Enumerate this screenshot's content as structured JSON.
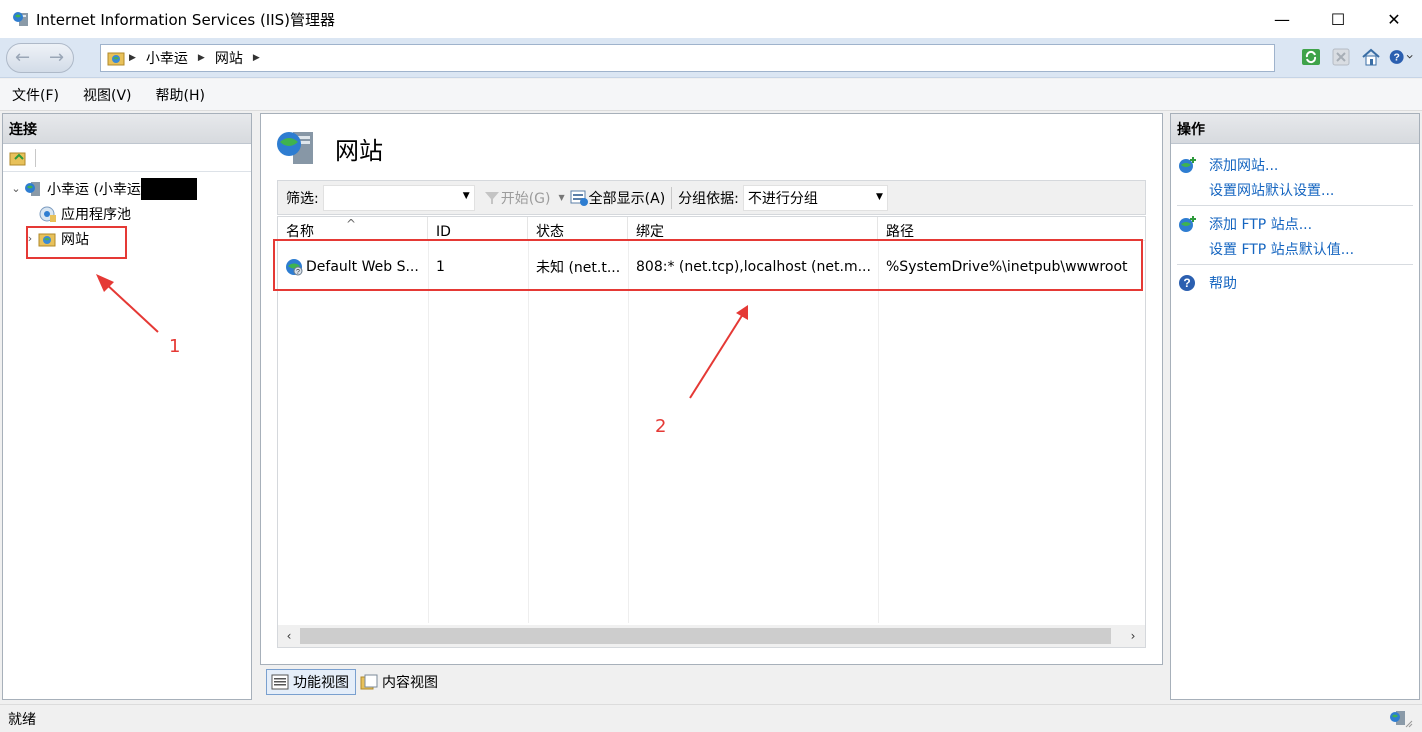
{
  "window": {
    "title": "Internet Information Services (IIS)管理器",
    "minimize": "—",
    "maximize": "☐",
    "close": "✕"
  },
  "address": {
    "crumbs": [
      "小幸运",
      "网站"
    ]
  },
  "menu": {
    "items": [
      "文件(F)",
      "视图(V)",
      "帮助(H)"
    ]
  },
  "connections": {
    "header": "连接",
    "server": "小幸运 (小幸运",
    "app_pools": "应用程序池",
    "sites": "网站"
  },
  "center": {
    "title": "网站",
    "toolbar": {
      "filter_label": "筛选:",
      "start": "开始(G)",
      "show_all": "全部显示(A)",
      "group_by_label": "分组依据:",
      "group_by_value": "不进行分组"
    },
    "columns": [
      "名称",
      "ID",
      "状态",
      "绑定",
      "路径"
    ],
    "rows": [
      {
        "name": "Default Web S...",
        "id": "1",
        "status": "未知 (net.t...",
        "binding": "808:* (net.tcp),localhost (net.m...",
        "path": "%SystemDrive%\\inetpub\\wwwroot"
      }
    ]
  },
  "view_tabs": {
    "features": "功能视图",
    "content": "内容视图"
  },
  "actions": {
    "header": "操作",
    "add_site": "添加网站...",
    "site_defaults": "设置网站默认设置...",
    "add_ftp": "添加 FTP 站点...",
    "ftp_defaults": "设置 FTP 站点默认值...",
    "help": "帮助"
  },
  "status": {
    "text": "就绪"
  },
  "annotations": {
    "label1": "1",
    "label2": "2",
    "color": "#e53935"
  }
}
